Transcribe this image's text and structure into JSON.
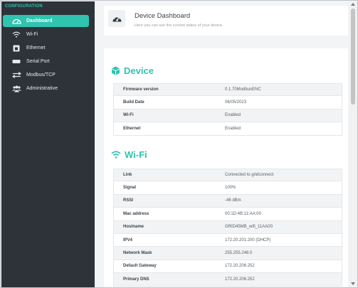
{
  "sidebar": {
    "heading": "CONFIGURATION",
    "items": [
      {
        "label": "Dashboard",
        "icon": "dashboard-icon",
        "active": true
      },
      {
        "label": "Wi-Fi",
        "icon": "wifi-icon",
        "active": false
      },
      {
        "label": "Ethernet",
        "icon": "ethernet-icon",
        "active": false
      },
      {
        "label": "Serial Port",
        "icon": "serial-port-icon",
        "active": false
      },
      {
        "label": "Modbus/TCP",
        "icon": "modbus-arrows-icon",
        "active": false
      },
      {
        "label": "Administrative",
        "icon": "users-icon",
        "active": false
      }
    ]
  },
  "header": {
    "title": "Device Dashboard",
    "subtitle": "Here you can see the current status of your device.",
    "icon": "speedometer-icon"
  },
  "device": {
    "title": "Device",
    "icon": "cube-icon",
    "rows": [
      {
        "key": "Firmware version",
        "value": "0.1.70ModbusENC"
      },
      {
        "key": "Build Date",
        "value": "06/05/2023"
      },
      {
        "key": "Wi-Fi",
        "value": "Enabled"
      },
      {
        "key": "Ethernet",
        "value": "Enabled"
      }
    ]
  },
  "wifi": {
    "title": "Wi-Fi",
    "icon": "wifi-icon",
    "rows": [
      {
        "key": "Link",
        "value": "Connected to gridconnect"
      },
      {
        "key": "Signal",
        "value": "100%"
      },
      {
        "key": "RSSI",
        "value": "-46 dBm"
      },
      {
        "key": "Mac address",
        "value": "00:1D:4B:11:AA:00"
      },
      {
        "key": "Hostname",
        "value": "GRID45MB_wifi_11AA00"
      },
      {
        "key": "IPV4",
        "value": "172.20.201.200 (DHCP)"
      },
      {
        "key": "Network Mask",
        "value": "255.255.248.0"
      },
      {
        "key": "Default Gateway",
        "value": "172.20.206.252"
      },
      {
        "key": "Primary DNS",
        "value": "172.20.206.252"
      }
    ]
  },
  "colors": {
    "accent": "#2ec4b0",
    "sidebar_bg": "#2d3339",
    "page_bg": "#f3f4f6"
  }
}
